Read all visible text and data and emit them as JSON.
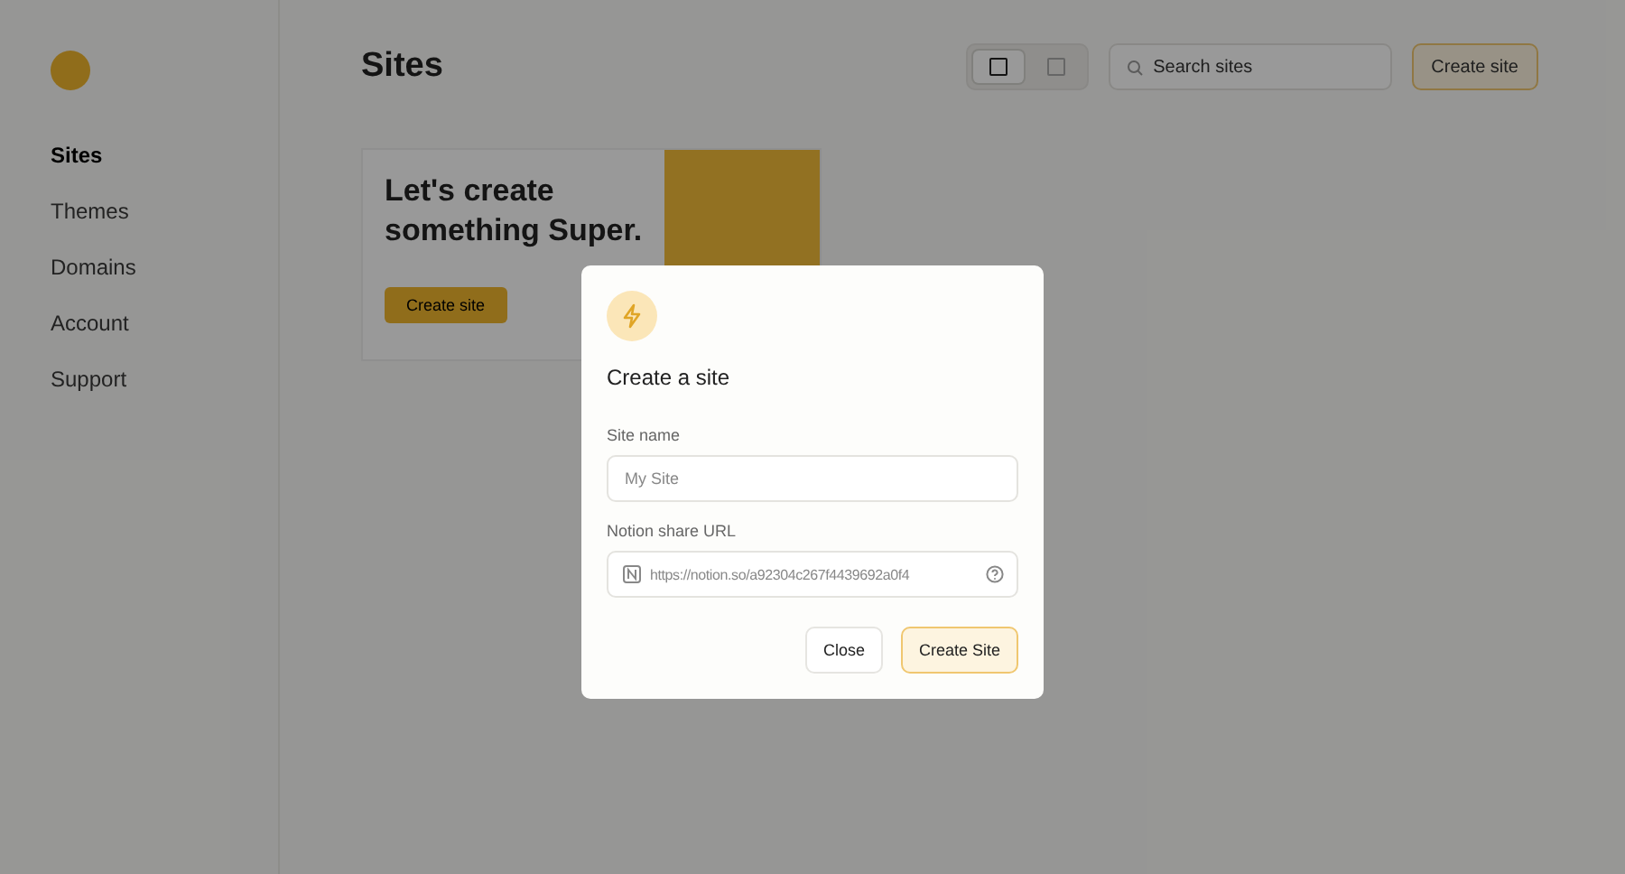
{
  "sidebar": {
    "items": [
      {
        "label": "Sites",
        "selected": true
      },
      {
        "label": "Themes",
        "selected": false
      },
      {
        "label": "Domains",
        "selected": false
      },
      {
        "label": "Account",
        "selected": false
      },
      {
        "label": "Support",
        "selected": false
      }
    ]
  },
  "header": {
    "title": "Sites",
    "view_toggle": [
      {
        "selected": true
      },
      {
        "selected": false
      }
    ],
    "search": {
      "placeholder": "Search sites"
    },
    "create_button": "Create site"
  },
  "hero": {
    "title": "Let's create something Super.",
    "button": "Create site"
  },
  "modal": {
    "title": "Create a site",
    "fields": [
      {
        "label": "Site name",
        "placeholder": "My Site",
        "kind": "text"
      },
      {
        "label": "Notion share URL",
        "placeholder": "https://notion.so/a92304c267f4439692a0f4",
        "kind": "notion"
      }
    ],
    "buttons": [
      {
        "label": "Close",
        "primary": false
      },
      {
        "label": "Create Site",
        "primary": true
      }
    ]
  }
}
